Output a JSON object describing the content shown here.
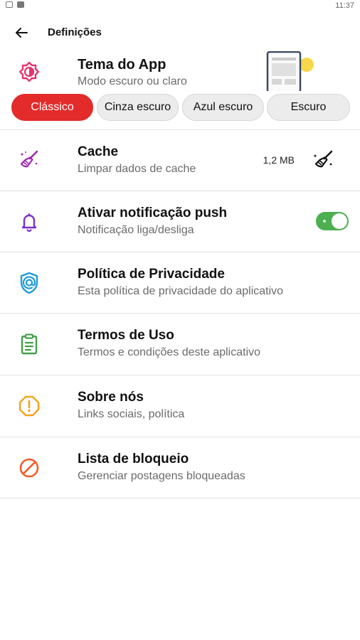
{
  "status_bar": {
    "time": "11:37"
  },
  "app_bar": {
    "title": "Definições"
  },
  "theme": {
    "title": "Tema do App",
    "subtitle": "Modo escuro ou claro",
    "options": [
      "Clássico",
      "Cinza escuro",
      "Azul escuro",
      "Escuro"
    ],
    "selected": "Clássico",
    "accent": "#e32b2b"
  },
  "cache": {
    "title": "Cache",
    "subtitle": "Limpar dados de cache",
    "size": "1,2 MB"
  },
  "push": {
    "title": "Ativar notificação push",
    "subtitle": "Notificação liga/desliga",
    "enabled": true
  },
  "privacy": {
    "title": "Política de Privacidade",
    "subtitle": "Esta política de privacidade do aplicativo"
  },
  "terms": {
    "title": "Termos de Uso",
    "subtitle": "Termos e condições deste aplicativo"
  },
  "about": {
    "title": "Sobre nós",
    "subtitle": "Links sociais, política"
  },
  "blocklist": {
    "title": "Lista de bloqueio",
    "subtitle": "Gerenciar postagens bloqueadas"
  },
  "colors": {
    "theme_icon": "#e8336d",
    "cache_icon": "#9c27b0",
    "push_icon": "#7b2fd1",
    "privacy_icon": "#1e9bd7",
    "terms_icon": "#43a047",
    "about_icon": "#f4a21a",
    "blocklist_icon": "#f25c2a",
    "toggle_on": "#4caf50"
  }
}
